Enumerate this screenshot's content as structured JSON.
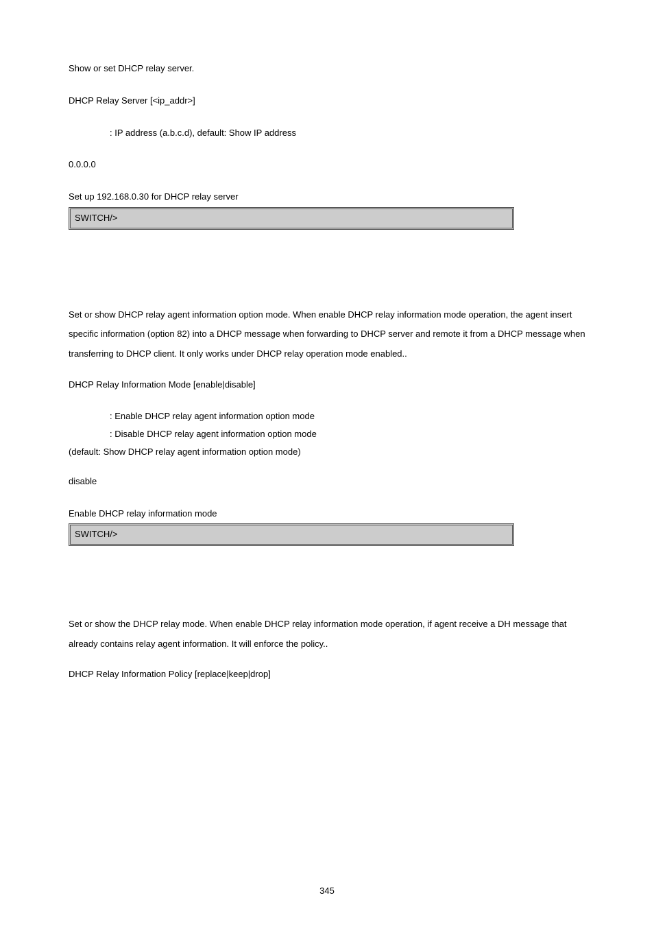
{
  "section1": {
    "desc": "Show or set DHCP relay server.",
    "syntax": "DHCP Relay Server [<ip_addr>]",
    "param1": ": IP address (a.b.c.d), default: Show IP address",
    "default_val": "0.0.0.0",
    "example_desc": "Set up 192.168.0.30 for DHCP relay server",
    "cli": "SWITCH/>"
  },
  "section2": {
    "desc": "Set or show DHCP relay agent information option mode. When enable DHCP relay information mode operation, the agent insert specific information (option 82) into a DHCP message when forwarding to DHCP server and remote it from a DHCP message when transferring to DHCP client. It only works under DHCP relay operation mode enabled..",
    "syntax": "DHCP Relay Information Mode [enable|disable]",
    "param1": ": Enable DHCP relay agent information option mode",
    "param2": ": Disable DHCP relay agent information option mode",
    "param_default": "(default: Show DHCP relay agent information option mode)",
    "default_val": "disable",
    "example_desc": "Enable DHCP relay information mode",
    "cli": "SWITCH/>"
  },
  "section3": {
    "desc": "Set or show the DHCP relay mode. When enable DHCP relay information mode operation, if agent receive a DH message that already contains relay agent information. It will enforce the policy..",
    "syntax": "DHCP Relay Information Policy [replace|keep|drop]"
  },
  "page_number": "345"
}
